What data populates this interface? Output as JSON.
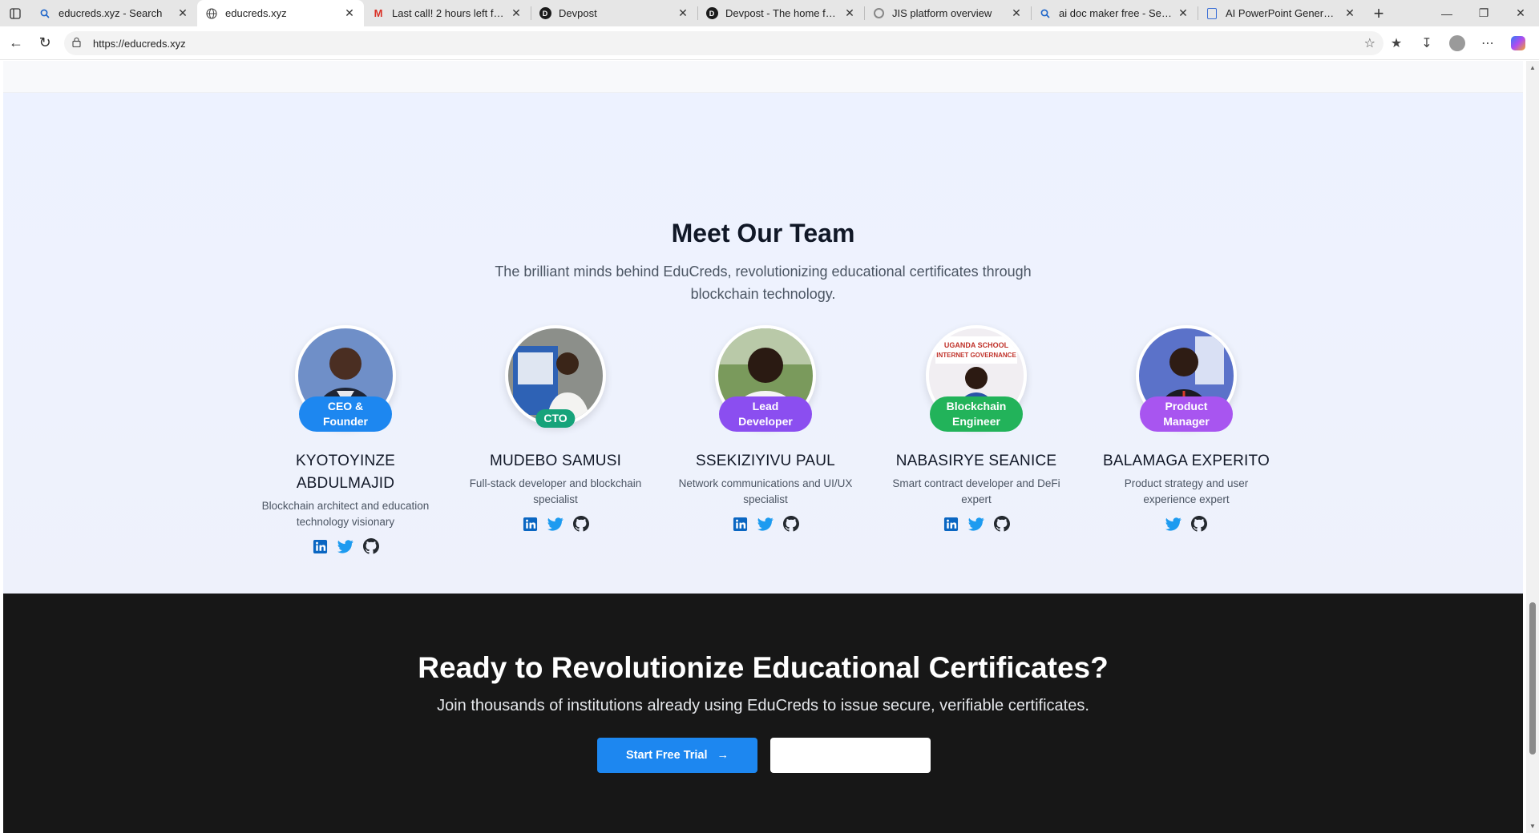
{
  "browser": {
    "tabs": [
      {
        "title": "educreds.xyz - Search",
        "icon": "search-icon"
      },
      {
        "title": "educreds.xyz",
        "icon": "globe-icon",
        "active": true
      },
      {
        "title": "Last call! 2 hours left for lat",
        "icon": "gmail-icon"
      },
      {
        "title": "Devpost",
        "icon": "devpost-icon"
      },
      {
        "title": "Devpost - The home for ha",
        "icon": "devpost-icon"
      },
      {
        "title": "JIS platform overview",
        "icon": "openai-icon"
      },
      {
        "title": "ai doc maker free - Search",
        "icon": "search-icon"
      },
      {
        "title": "AI PowerPoint Generator -",
        "icon": "doc-icon"
      }
    ],
    "url": "https://educreds.xyz"
  },
  "team": {
    "heading": "Meet Our Team",
    "subtitle": "The brilliant minds behind EduCreds, revolutionizing educational certificates through blockchain technology.",
    "members": [
      {
        "name": "KYOTOYINZE ABDULMAJID",
        "role": "CEO & Founder",
        "role_color": "#1d87f0",
        "description": "Blockchain architect and education technology visionary",
        "socials": [
          "linkedin",
          "twitter",
          "github"
        ]
      },
      {
        "name": "MUDEBO SAMUSI",
        "role": "CTO",
        "role_color": "#16a37a",
        "description": "Full-stack developer and blockchain specialist",
        "socials": [
          "linkedin",
          "twitter",
          "github"
        ]
      },
      {
        "name": "SSEKIZIYIVU PAUL",
        "role": "Lead Developer",
        "role_color": "#8b4ef0",
        "description": "Network communications and UI/UX specialist",
        "socials": [
          "linkedin",
          "twitter",
          "github"
        ]
      },
      {
        "name": "NABASIRYE SEANICE",
        "role": "Blockchain Engineer",
        "role_color": "#22b35a",
        "description": "Smart contract developer and DeFi expert",
        "socials": [
          "linkedin",
          "twitter",
          "github"
        ]
      },
      {
        "name": "BALAMAGA EXPERITO",
        "role": "Product Manager",
        "role_color": "#a855f0",
        "description": "Product strategy and user experience expert",
        "socials": [
          "twitter",
          "github"
        ]
      }
    ]
  },
  "cta": {
    "heading": "Ready to Revolutionize Educational Certificates?",
    "subtitle": "Join thousands of institutions already using EduCreds to issue secure, verifiable certificates.",
    "primary_label": "Start Free Trial",
    "secondary_label": ""
  },
  "colors": {
    "linkedin": "#0a66c2",
    "twitter": "#1d9bf0",
    "github": "#24292f",
    "cta_bg": "#171717",
    "primary": "#1d87f0"
  }
}
